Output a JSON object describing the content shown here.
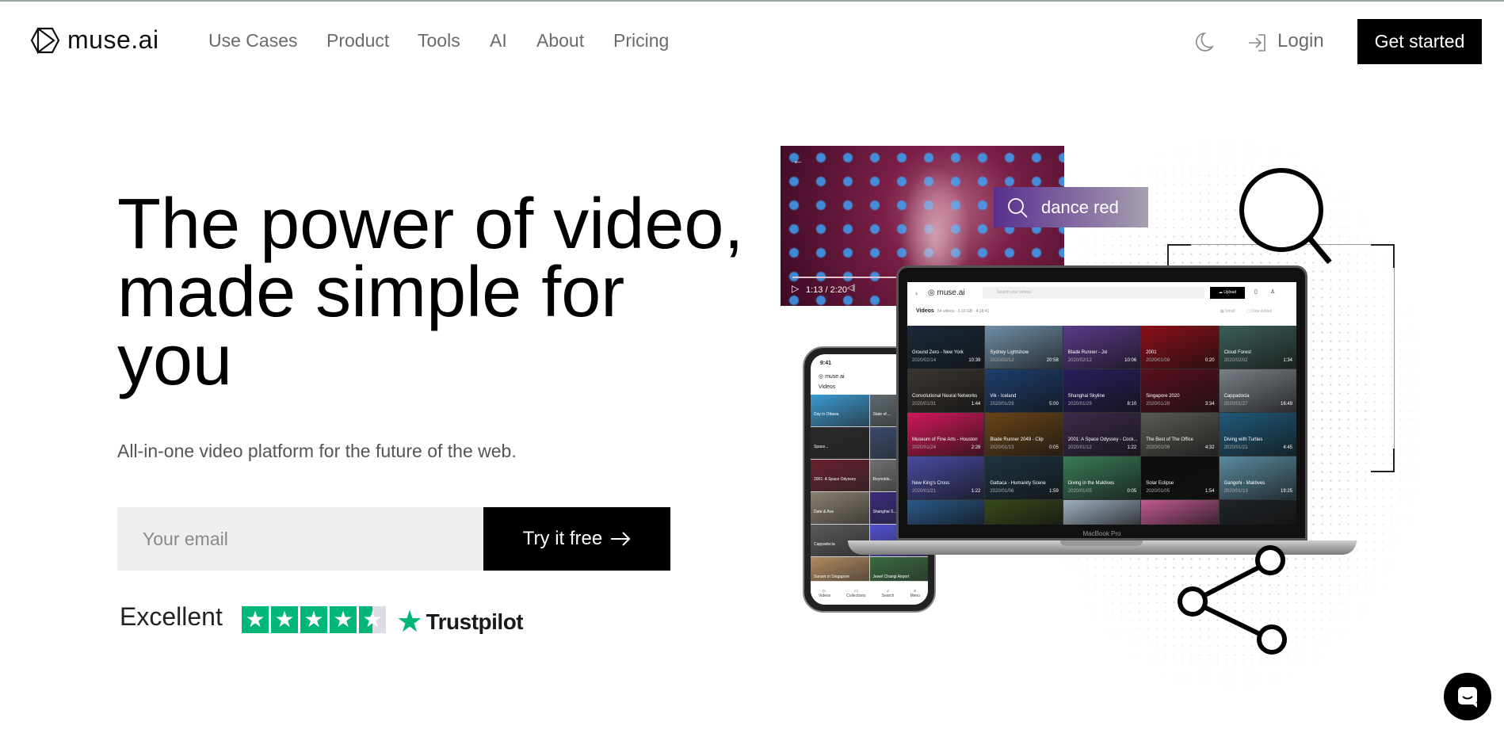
{
  "header": {
    "logo": "muse.ai",
    "nav": [
      "Use Cases",
      "Product",
      "Tools",
      "AI",
      "About",
      "Pricing"
    ],
    "login": "Login",
    "get_started": "Get started"
  },
  "hero": {
    "title_lines": [
      "The power of video,",
      "made simple for",
      "you"
    ],
    "subtitle": "All-in-one video platform for the future of the web.",
    "email_placeholder": "Your email",
    "try_label": "Try it free",
    "rating_label": "Excellent",
    "rating_stars": 4.5,
    "trustpilot": "Trustpilot"
  },
  "colors": {
    "accent": "#000000",
    "trustpilot": "#00b67a"
  },
  "video_panel": {
    "time": "1:13 / 2:20",
    "search_query": "dance red",
    "progress": 0.52
  },
  "laptop": {
    "logo": "muse.ai",
    "search_placeholder": "Search your videos",
    "upload": "Upload",
    "heading": "Videos",
    "stats": "54 videos · 3.10 GB · 4:18:41",
    "view": "Small",
    "sort": "Date Added",
    "brand": "MacBook Pro",
    "videos": [
      {
        "title": "Ground Zero - New York",
        "date": "2020/02/14",
        "dur": "10:39",
        "c": "#1b2a3a"
      },
      {
        "title": "Sydney Lightshow",
        "date": "2020/02/12",
        "dur": "20:58",
        "c": "#6f8fa8"
      },
      {
        "title": "Blade Runner - Joi",
        "date": "2020/02/12",
        "dur": "10:06",
        "c": "#5a3b8a"
      },
      {
        "title": "2001",
        "date": "2020/01/09",
        "dur": "0:20",
        "c": "#8a0f18"
      },
      {
        "title": "Cloud Forest",
        "date": "2020/02/02",
        "dur": "1:34",
        "c": "#3c5e58"
      },
      {
        "title": "Convolutional Neural Networks",
        "date": "2020/01/31",
        "dur": "1:44",
        "c": "#3a3530"
      },
      {
        "title": "Vik - Iceland",
        "date": "2020/01/29",
        "dur": "5:00",
        "c": "#1d3e6e"
      },
      {
        "title": "Shanghai Skyline",
        "date": "2020/01/29",
        "dur": "8:10",
        "c": "#2a1f5e"
      },
      {
        "title": "Singapore 2020",
        "date": "2020/01/28",
        "dur": "3:34",
        "c": "#5a1020"
      },
      {
        "title": "Cappadocia",
        "date": "2020/01/27",
        "dur": "16:49",
        "c": "#7a7f86"
      },
      {
        "title": "Museum of Fine Arts - Houston",
        "date": "2020/01/24",
        "dur": "2:28",
        "c": "#d0185a"
      },
      {
        "title": "Blade Runner 2049 - Clip",
        "date": "2020/01/13",
        "dur": "0:05",
        "c": "#6a4418"
      },
      {
        "title": "2001: A Space Odyssey - Cock...",
        "date": "2020/01/12",
        "dur": "1:22",
        "c": "#3b2a4a"
      },
      {
        "title": "The Best of The Office",
        "date": "2020/01/09",
        "dur": "4:32",
        "c": "#5a5a55"
      },
      {
        "title": "Diving with Turtles",
        "date": "2020/01/21",
        "dur": "4:45",
        "c": "#1f5a7a"
      },
      {
        "title": "New King's Cross",
        "date": "2020/01/21",
        "dur": "1:22",
        "c": "#4a4aa0"
      },
      {
        "title": "Gattaca - Humanity Scene",
        "date": "2020/01/06",
        "dur": "1:59",
        "c": "#1e3440"
      },
      {
        "title": "Diving in the Maldives",
        "date": "2020/01/05",
        "dur": "0:05",
        "c": "#3a7a5a"
      },
      {
        "title": "Solar Eclipse",
        "date": "2020/01/05",
        "dur": "1:54",
        "c": "#0d0d0d"
      },
      {
        "title": "Gangehi - Maldives",
        "date": "2020/01/13",
        "dur": "19:25",
        "c": "#5a8aa0"
      },
      {
        "title": "",
        "date": "",
        "dur": "",
        "c": "#2a5a8a"
      },
      {
        "title": "",
        "date": "",
        "dur": "",
        "c": "#3a4a1a"
      },
      {
        "title": "",
        "date": "",
        "dur": "",
        "c": "#a0b0c0"
      },
      {
        "title": "",
        "date": "",
        "dur": "",
        "c": "#c05a90"
      },
      {
        "title": "",
        "date": "",
        "dur": "",
        "c": "#202428"
      }
    ]
  },
  "phone": {
    "time": "9:41",
    "logo": "muse.ai",
    "heading": "Videos",
    "videos": [
      {
        "title": "Day in Ottawa",
        "c": "#3a9ad0"
      },
      {
        "title": "State of ...",
        "c": "#606a70"
      },
      {
        "title": "Space...",
        "c": "#2a2a2a"
      },
      {
        "title": "",
        "c": "#3a4a6a"
      },
      {
        "title": "2001: A Space Odyssey",
        "c": "#6a2030"
      },
      {
        "title": "Reynolds...",
        "c": "#707070"
      },
      {
        "title": "Date & Ava",
        "c": "#8a8070"
      },
      {
        "title": "Shanghai S...",
        "c": "#3a2a7a"
      },
      {
        "title": "Cappadocia",
        "c": "#5a5a5a"
      },
      {
        "title": "",
        "c": "#5050d0"
      },
      {
        "title": "Sunset in Singapore",
        "c": "#b08a60"
      },
      {
        "title": "Jewel Changi Airport",
        "c": "#3a6a40"
      }
    ],
    "tabs": [
      "Videos",
      "Collections",
      "Search",
      "Menu"
    ]
  }
}
